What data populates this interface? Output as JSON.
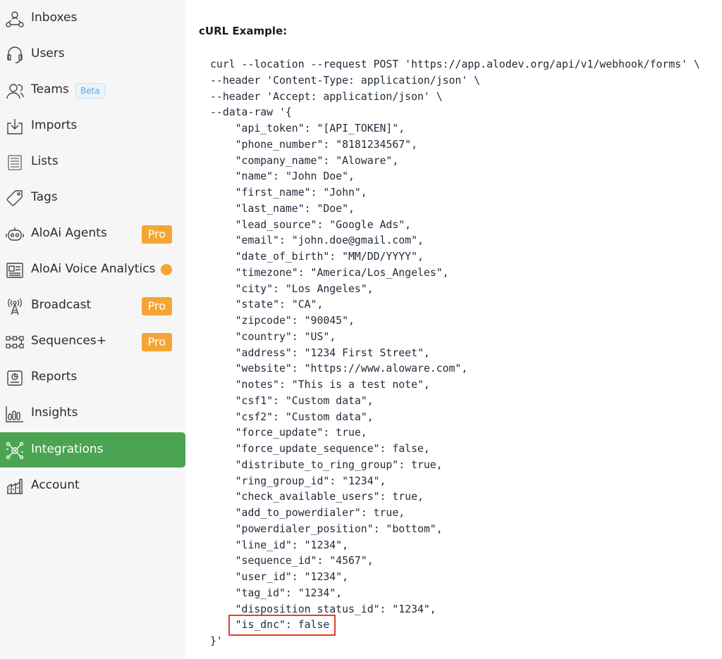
{
  "sidebar": {
    "items": [
      {
        "label": "Inboxes",
        "icon": "inboxes-icon"
      },
      {
        "label": "Users",
        "icon": "users-icon"
      },
      {
        "label": "Teams",
        "icon": "teams-icon",
        "badge": "Beta"
      },
      {
        "label": "Imports",
        "icon": "imports-icon"
      },
      {
        "label": "Lists",
        "icon": "lists-icon"
      },
      {
        "label": "Tags",
        "icon": "tags-icon"
      },
      {
        "label": "AloAi Agents",
        "icon": "robot-icon",
        "badge": "Pro"
      },
      {
        "label": "AloAi Voice Analytics",
        "icon": "voice-analytics-icon"
      },
      {
        "label": "Broadcast",
        "icon": "broadcast-icon",
        "badge": "Pro"
      },
      {
        "label": "Sequences+",
        "icon": "sequences-icon",
        "badge": "Pro"
      },
      {
        "label": "Reports",
        "icon": "reports-icon"
      },
      {
        "label": "Insights",
        "icon": "insights-icon"
      },
      {
        "label": "Integrations",
        "icon": "integrations-icon",
        "active": true
      },
      {
        "label": "Account",
        "icon": "account-icon"
      }
    ]
  },
  "main": {
    "title": "cURL Example:",
    "code_lines": [
      "curl --location --request POST 'https://app.alodev.org/api/v1/webhook/forms' \\",
      "--header 'Content-Type: application/json' \\",
      "--header 'Accept: application/json' \\",
      "--data-raw '{",
      "    \"api_token\": \"[API_TOKEN]\",",
      "    \"phone_number\": \"8181234567\",",
      "    \"company_name\": \"Aloware\",",
      "    \"name\": \"John Doe\",",
      "    \"first_name\": \"John\",",
      "    \"last_name\": \"Doe\",",
      "    \"lead_source\": \"Google Ads\",",
      "    \"email\": \"john.doe@gmail.com\",",
      "    \"date_of_birth\": \"MM/DD/YYYY\",",
      "    \"timezone\": \"America/Los_Angeles\",",
      "    \"city\": \"Los Angeles\",",
      "    \"state\": \"CA\",",
      "    \"zipcode\": \"90045\",",
      "    \"country\": \"US\",",
      "    \"address\": \"1234 First Street\",",
      "    \"website\": \"https://www.aloware.com\",",
      "    \"notes\": \"This is a test note\",",
      "    \"csf1\": \"Custom data\",",
      "    \"csf2\": \"Custom data\",",
      "    \"force_update\": true,",
      "    \"force_update_sequence\": false,",
      "    \"distribute_to_ring_group\": true,",
      "    \"ring_group_id\": \"1234\",",
      "    \"check_available_users\": true,",
      "    \"add_to_powerdialer\": true,",
      "    \"powerdialer_position\": \"bottom\",",
      "    \"line_id\": \"1234\",",
      "    \"sequence_id\": \"4567\",",
      "    \"user_id\": \"1234\",",
      "    \"tag_id\": \"1234\",",
      "    \"disposition_status_id\": \"1234\",",
      "    \"is_dnc\": false",
      "}'"
    ]
  },
  "colors": {
    "active_bg": "#4aa452",
    "pro_badge": "#f4a534",
    "highlight_border": "#e0402e"
  }
}
